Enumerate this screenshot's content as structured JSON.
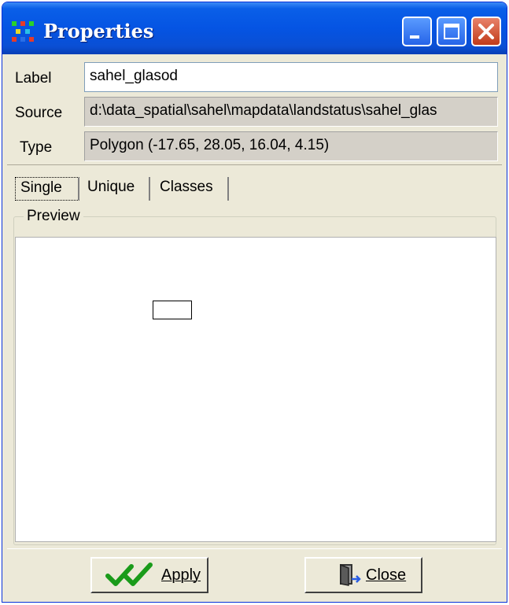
{
  "window": {
    "title": "Properties"
  },
  "fields": {
    "label": {
      "caption": "Label",
      "value": "sahel_glasod"
    },
    "source": {
      "caption": "Source",
      "value": "d:\\data_spatial\\sahel\\mapdata\\landstatus\\sahel_glas"
    },
    "type": {
      "caption": "Type",
      "value": "Polygon  (-17.65, 28.05, 16.04, 4.15)"
    }
  },
  "tabs": [
    {
      "label": "Single",
      "active": true
    },
    {
      "label": "Unique",
      "active": false
    },
    {
      "label": "Classes",
      "active": false
    }
  ],
  "preview": {
    "legend": "Preview"
  },
  "buttons": {
    "apply": "Apply",
    "close": "Close"
  },
  "icons": {
    "app": "app-grid-icon",
    "apply": "double-check-icon",
    "close": "door-exit-icon"
  },
  "colors": {
    "titlebar": "#0554e3",
    "close_button": "#c13b1a",
    "check_green": "#1a9b1a"
  }
}
